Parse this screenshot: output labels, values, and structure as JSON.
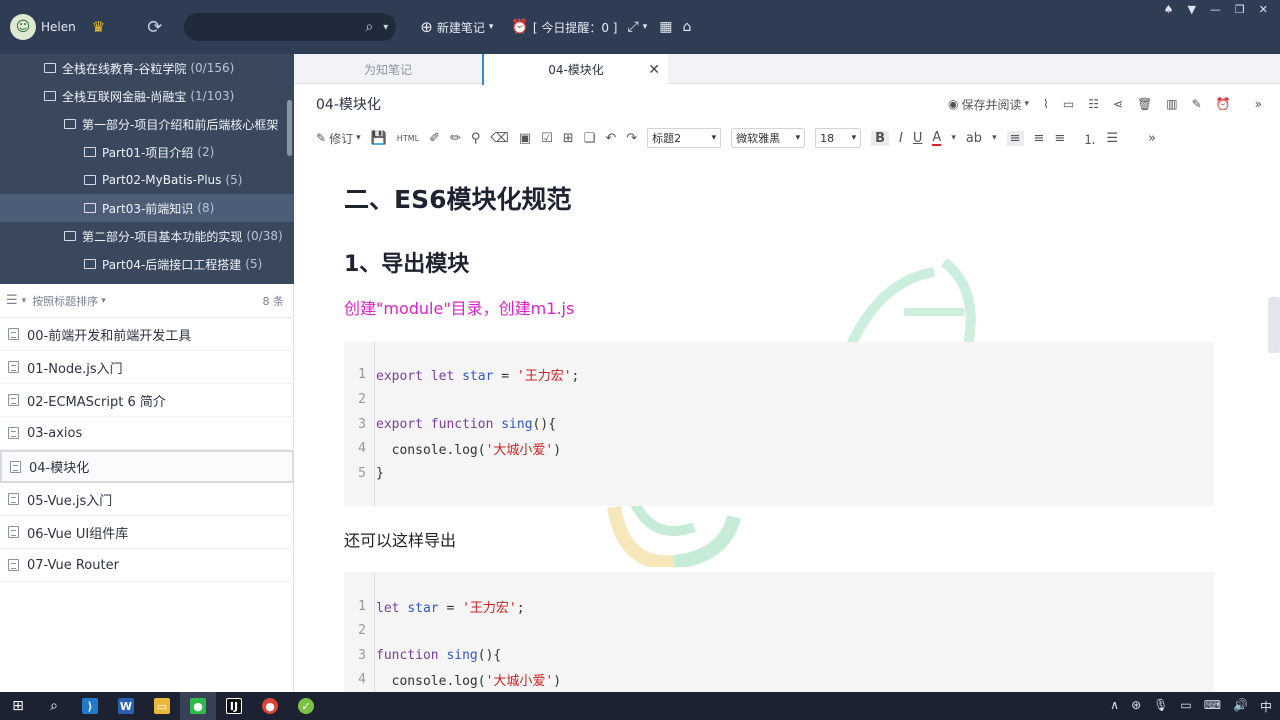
{
  "user": {
    "name": "Helen"
  },
  "topbar": {
    "new_note": "新建笔记",
    "reminder": "[ 今日提醒：0 ]",
    "window_controls": [
      "shirt-icon",
      "menu-icon",
      "minimize-icon",
      "restore-icon",
      "close-icon"
    ]
  },
  "tree": [
    {
      "label": "全栈在线教育-谷粒学院",
      "count": "(0/156)"
    },
    {
      "label": "全栈互联网金融-尚融宝",
      "count": "(1/103)"
    },
    {
      "label": "第一部分-项目介绍和前后端核心框架",
      "count": ""
    },
    {
      "label": "Part01-项目介绍",
      "count": "(2)"
    },
    {
      "label": "Part02-MyBatis-Plus",
      "count": "(5)"
    },
    {
      "label": "Part03-前端知识",
      "count": "(8)"
    },
    {
      "label": "第二部分-项目基本功能的实现",
      "count": "(0/38)"
    },
    {
      "label": "Part04-后端接口工程搭建",
      "count": "(5)"
    }
  ],
  "sortbar": {
    "label": "按照标题排序",
    "count": "8 条"
  },
  "notes": [
    "00-前端开发和前端开发工具",
    "01-Node.js入门",
    "02-ECMAScript 6 简介",
    "03-axios",
    "04-模块化",
    "05-Vue.js入门",
    "06-Vue UI组件库",
    "07-Vue Router"
  ],
  "tabs": {
    "first": "为知笔记",
    "active": "04-模块化"
  },
  "doc": {
    "title": "04-模块化",
    "save_read": "保存并阅读",
    "heading_select": "标题2",
    "font_select": "微软雅黑",
    "size_select": "18",
    "revise": "修订"
  },
  "content": {
    "h2": "二、ES6模块化规范",
    "h3": "1、导出模块",
    "pink_note": "创建\"module\"目录，创建m1.js",
    "plain_note": "还可以这样导出"
  },
  "code1": {
    "line_numbers": [
      "1",
      "2",
      "3",
      "4",
      "5"
    ],
    "l1_kw": "export let ",
    "l1_var": "star",
    "l1_eq": " = ",
    "l1_str": "'王力宏'",
    "l1_end": ";",
    "l3_kw": "export function ",
    "l3_fn": "sing",
    "l3_end": "(){",
    "l4_pre": "  console.log(",
    "l4_str": "'大城小爱'",
    "l4_end": ")",
    "l5": "}"
  },
  "code2": {
    "line_numbers": [
      "1",
      "2",
      "3",
      "4"
    ],
    "l1_kw": "let ",
    "l1_var": "star",
    "l1_eq": " = ",
    "l1_str": "'王力宏'",
    "l1_end": ";",
    "l3_kw": "function ",
    "l3_fn": "sing",
    "l3_end": "(){",
    "l4_pre": "  console.log(",
    "l4_str": "'大城小爱'",
    "l4_end": ")"
  },
  "taskbar": {
    "tray_ime": "中"
  },
  "colors": {
    "topbar": "#2e3d54",
    "tree_bg": "#3a485e",
    "pink": "#e020c8",
    "accent": "#3a86d6"
  }
}
